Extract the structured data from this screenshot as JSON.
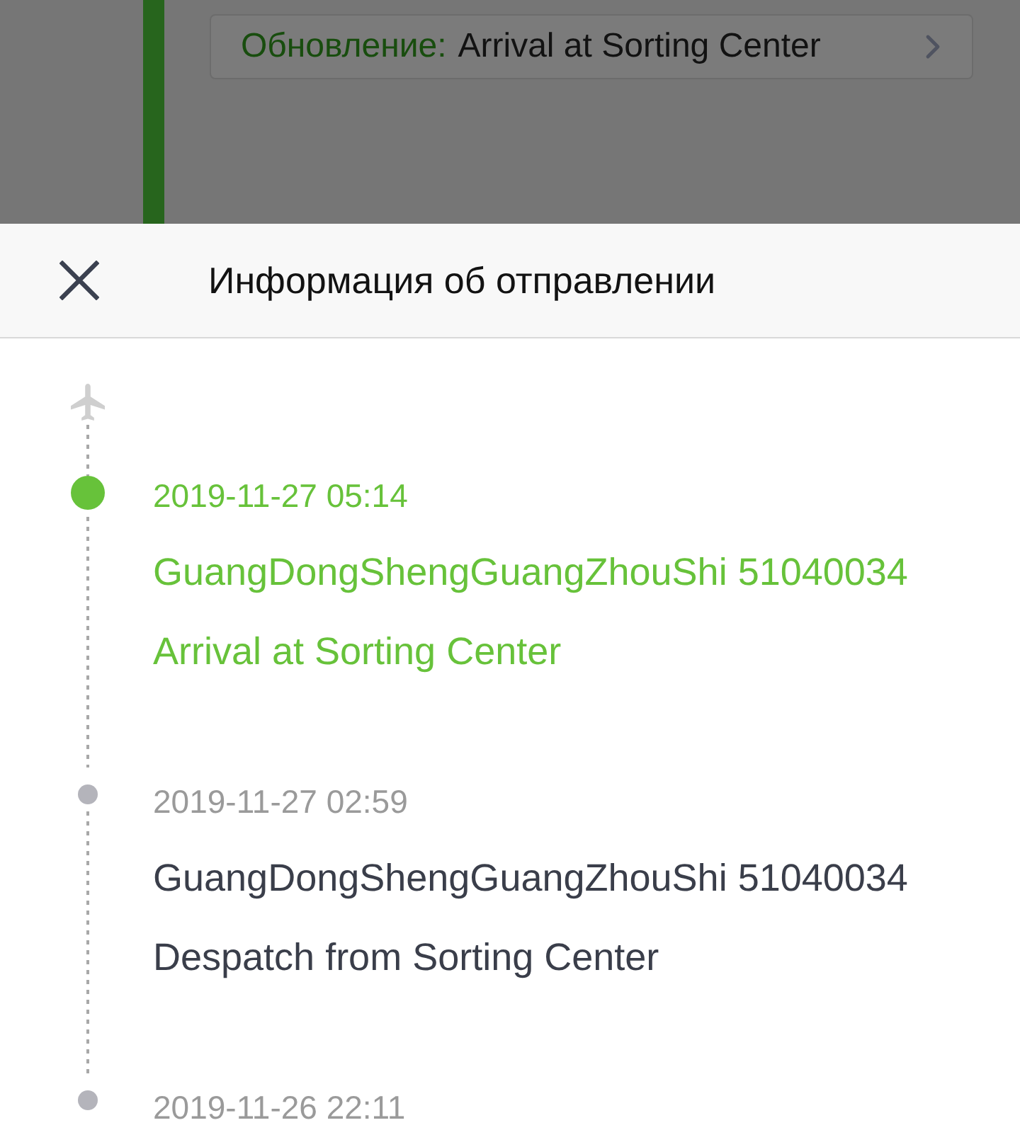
{
  "background": {
    "update": {
      "label": "Обновление:",
      "status": "Arrival at Sorting Center"
    }
  },
  "sheet": {
    "title": "Информация об отправлении"
  },
  "events": [
    {
      "time": "2019-11-27 05:14",
      "location": "GuangDongShengGuangZhouShi 51040034",
      "status": "Arrival at Sorting Center",
      "current": true
    },
    {
      "time": "2019-11-27 02:59",
      "location": "GuangDongShengGuangZhouShi 51040034",
      "status": "Despatch from Sorting Center",
      "current": false
    },
    {
      "time": "2019-11-26 22:11",
      "current": false
    }
  ]
}
